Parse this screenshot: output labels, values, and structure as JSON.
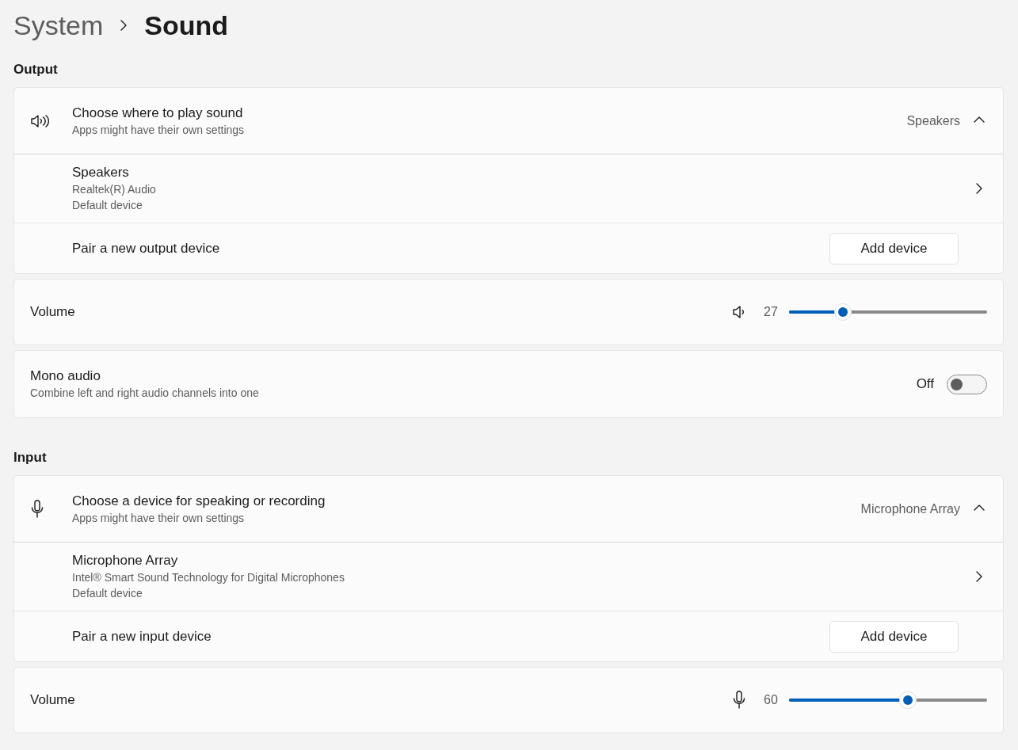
{
  "breadcrumb": {
    "parent": "System",
    "current": "Sound"
  },
  "sections": [
    {
      "heading": "Output",
      "kind": "output",
      "group": {
        "title": "Choose where to play sound",
        "subtitle": "Apps might have their own settings",
        "value": "Speakers",
        "expanded": true,
        "device": {
          "name": "Speakers",
          "lines": [
            "Realtek(R) Audio",
            "Default device"
          ]
        },
        "pair": {
          "label": "Pair a new output device",
          "button": "Add device"
        }
      },
      "settings": [
        {
          "kind": "volume",
          "label": "Volume",
          "reading": "27",
          "level": 0.27
        },
        {
          "kind": "toggle",
          "label": "Mono audio",
          "description": "Combine left and right audio channels into one",
          "state_label": "Off",
          "on": false
        }
      ]
    },
    {
      "heading": "Input",
      "kind": "input",
      "group": {
        "title": "Choose a device for speaking or recording",
        "subtitle": "Apps might have their own settings",
        "value": "Microphone Array",
        "expanded": true,
        "device": {
          "name": "Microphone Array",
          "lines": [
            "Intel® Smart Sound Technology for Digital Microphones",
            "Default device"
          ]
        },
        "pair": {
          "label": "Pair a new input device",
          "button": "Add device"
        }
      },
      "settings": [
        {
          "kind": "volume",
          "label": "Volume",
          "reading": "60",
          "level": 0.6
        }
      ]
    }
  ]
}
